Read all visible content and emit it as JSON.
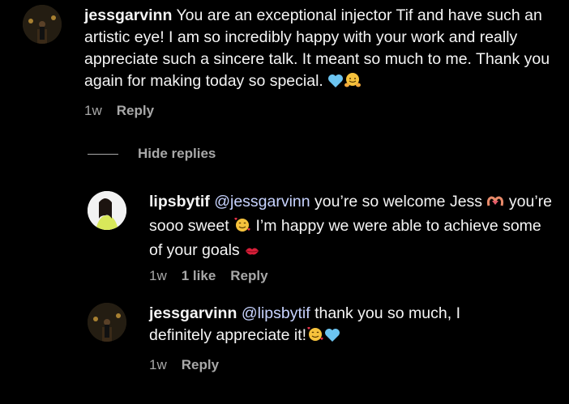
{
  "comment": {
    "username": "jessgarvinn",
    "text": "You are an exceptional injector Tif and have such an artistic eye! I am so incredibly happy with your work and really appreciate such a sincere talk. It meant so much to me. Thank you again for making today so special.",
    "emojis": [
      "blue-heart",
      "hugging-face"
    ],
    "time": "1w",
    "reply_label": "Reply"
  },
  "hide_replies_label": "Hide replies",
  "replies": [
    {
      "username": "lipsbytif",
      "mention": "@jessgarvinn",
      "text_part1": "you’re so welcome Jess",
      "text_part2": "you’re sooo sweet",
      "text_part3": "I’m happy we were able to achieve some of your goals",
      "emojis": [
        "heart-hands",
        "smiling-face-with-hearts",
        "kiss-mark"
      ],
      "time": "1w",
      "likes": "1 like",
      "reply_label": "Reply"
    },
    {
      "username": "jessgarvinn",
      "mention": "@lipsbytif",
      "text": "thank you so much, I definitely appreciate it!",
      "emojis": [
        "smiling-face-with-hearts",
        "blue-heart"
      ],
      "time": "1w",
      "reply_label": "Reply"
    }
  ]
}
